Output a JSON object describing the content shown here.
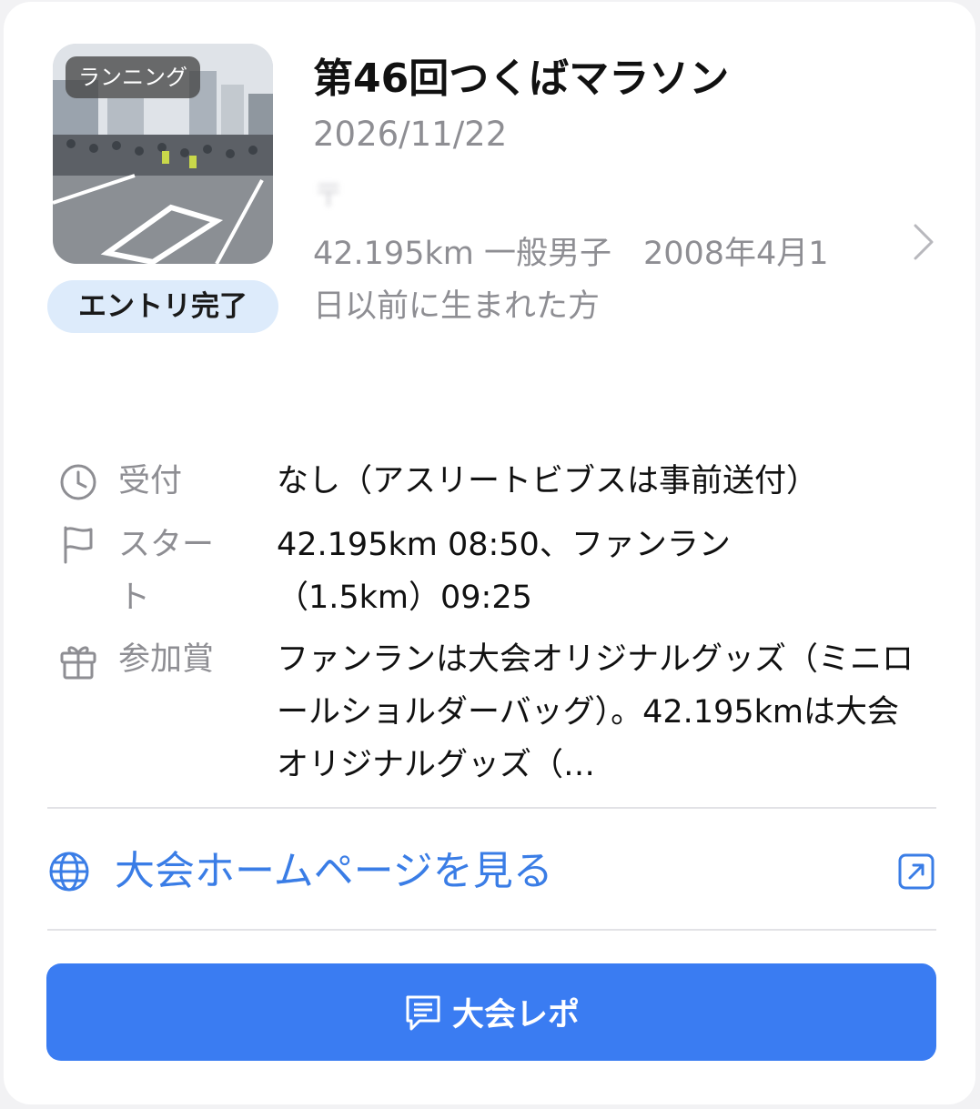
{
  "event": {
    "category_badge": "ランニング",
    "entry_status": "エントリ完了",
    "title": "第46回つくばマラソン",
    "date": "2026/11/22",
    "blurred_text": "〒",
    "entry_category": "42.195km 一般男子　2008年4月1日以前に生まれた方"
  },
  "info": {
    "reception": {
      "icon": "clock-icon",
      "label": "受付",
      "value": "なし（アスリートビブスは事前送付）"
    },
    "start": {
      "icon": "flag-icon",
      "label": "スタート",
      "value": "42.195km 08:50、ファンラン（1.5km）09:25"
    },
    "prize": {
      "icon": "gift-icon",
      "label": "参加賞",
      "value": "ファンランは大会オリジナルグッズ（ミニロールショルダーバッグ）。42.195kmは大会オリジナルグッズ（…"
    }
  },
  "homepage": {
    "icon": "globe-icon",
    "label": "大会ホームページを見る",
    "action_icon": "external-link-icon"
  },
  "report_button": {
    "icon": "message-icon",
    "label": "大会レポ"
  },
  "colors": {
    "accent": "#3a7de6",
    "button": "#3a7cf2",
    "badge_bg": "#ddebfb",
    "muted": "#8e8e93"
  }
}
